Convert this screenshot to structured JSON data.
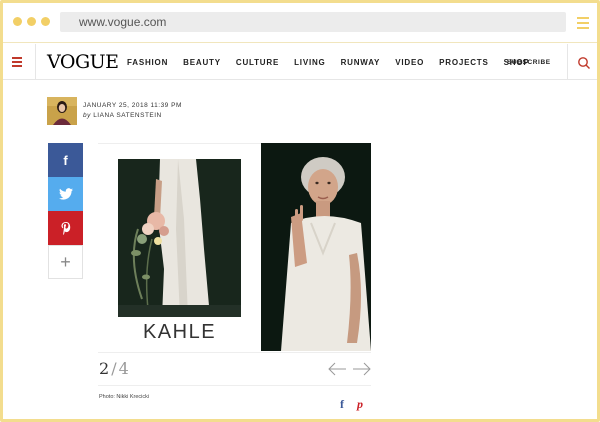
{
  "browser": {
    "url": "www.vogue.com"
  },
  "nav": {
    "logo": "VOGUE",
    "links": [
      "FASHION",
      "BEAUTY",
      "CULTURE",
      "LIVING",
      "RUNWAY",
      "VIDEO",
      "PROJECTS",
      "SHOP"
    ],
    "subscribe": "SUBSCRIBE"
  },
  "byline": {
    "date": "JANUARY 25, 2018 11:39 PM",
    "by": "by",
    "author": "LIANA SATENSTEIN"
  },
  "share": {
    "facebook_glyph": "f",
    "twitter_glyph": "t",
    "pinterest_glyph": "p",
    "more_glyph": "+"
  },
  "gallery": {
    "caption_brand": "KAHLE",
    "current": "2",
    "separator": "/",
    "total": "4",
    "photo_credit": "Photo: Nikki Krecicki",
    "credit_facebook_glyph": "f",
    "credit_pinterest_glyph": "p"
  },
  "colors": {
    "frame": "#f3dd8e",
    "chrome_accent": "#f2cf66",
    "brand_red": "#c0392b",
    "facebook": "#3b5998",
    "twitter": "#55acee",
    "pinterest": "#cb2027"
  }
}
